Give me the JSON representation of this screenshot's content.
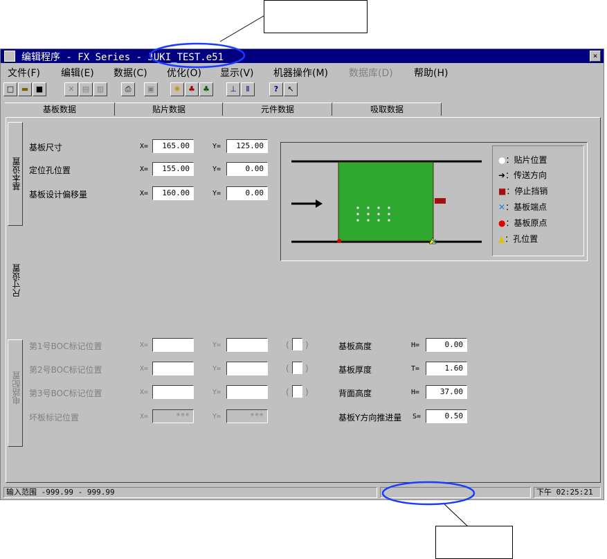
{
  "window": {
    "title": "编辑程序  - FX Series - JUKI_TEST.e51",
    "close_glyph": "×"
  },
  "menu": [
    {
      "label": "文件(F)"
    },
    {
      "label": "编辑(E)"
    },
    {
      "label": "数据(C)"
    },
    {
      "label": "优化(O)"
    },
    {
      "label": "显示(V)"
    },
    {
      "label": "机器操作(M)"
    },
    {
      "label": "数据库(D)"
    },
    {
      "label": "帮助(H)"
    }
  ],
  "toolbar_icons": [
    "new-icon",
    "open-icon",
    "save-icon",
    "cut-icon",
    "copy-icon",
    "paste-icon",
    "print-icon",
    "find-icon",
    "bulb-icon",
    "tree-icon",
    "group-icon",
    "align-icon",
    "column-icon",
    "help-icon",
    "context-help-icon"
  ],
  "tabs": [
    "基板数据",
    "贴片数据",
    "元件数据",
    "吸取数据"
  ],
  "side_tabs": {
    "basic": "基本设置",
    "size": "尺寸设置",
    "circuit": "电路配置"
  },
  "board": {
    "size": {
      "label": "基板尺寸",
      "x": "165.00",
      "y": "125.00"
    },
    "hole": {
      "label": "定位孔位置",
      "x": "155.00",
      "y": "0.00"
    },
    "offset": {
      "label": "基板设计偏移量",
      "x": "160.00",
      "y": "0.00"
    },
    "x_prefix": "X=",
    "y_prefix": "Y="
  },
  "legend": {
    "mount": "：贴片位置",
    "direction": "：传送方向",
    "stopper": "：停止挡销",
    "corner": "：基板端点",
    "origin": "：基板原点",
    "hole": "：孔位置"
  },
  "marks": [
    {
      "label": "第1号BOC标记位置",
      "x": "",
      "y": ""
    },
    {
      "label": "第2号BOC标记位置",
      "x": "",
      "y": ""
    },
    {
      "label": "第3号BOC标记位置",
      "x": "",
      "y": ""
    },
    {
      "label": "坏板标记位置",
      "x": "***",
      "y": "***"
    }
  ],
  "paren_open": "(",
  "paren_close": ")",
  "heights": [
    {
      "label": "基板高度",
      "prefix": "H=",
      "value": "0.00"
    },
    {
      "label": "基板厚度",
      "prefix": "T=",
      "value": "1.60"
    },
    {
      "label": "背面高度",
      "prefix": "H=",
      "value": "37.00"
    },
    {
      "label": "基板Y方向推进量",
      "prefix": "S=",
      "value": "0.50"
    }
  ],
  "status": {
    "range": "输入范围  -999.99 - 999.99",
    "time": "下午 02:25:21"
  },
  "colors": {
    "titlebar": "#000080",
    "board": "#2ea82e",
    "highlight": "#1a3cff"
  }
}
